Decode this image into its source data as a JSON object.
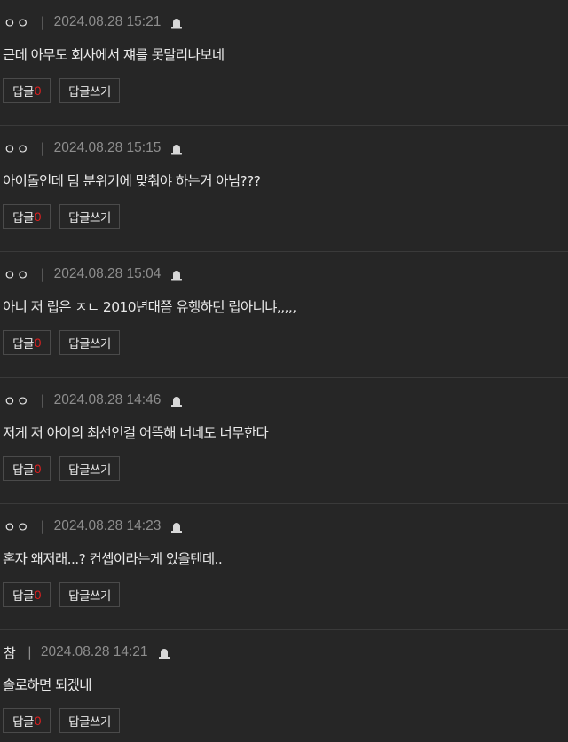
{
  "comments": [
    {
      "author": "ㅇㅇ",
      "separator": "|",
      "date": "2024.08.28 15:21",
      "text": "근데 아무도 회사에서 쟤를 못말리나보네",
      "reply_label": "답글",
      "reply_count": "0",
      "write_reply_label": "답글쓰기"
    },
    {
      "author": "ㅇㅇ",
      "separator": "|",
      "date": "2024.08.28 15:15",
      "text": "아이돌인데 팀 분위기에 맞춰야 하는거 아님???",
      "reply_label": "답글",
      "reply_count": "0",
      "write_reply_label": "답글쓰기"
    },
    {
      "author": "ㅇㅇ",
      "separator": "|",
      "date": "2024.08.28 15:04",
      "text": "아니 저 립은 ㅈㄴ 2010년대쯤 유행하던 립아니냐,,,,,",
      "reply_label": "답글",
      "reply_count": "0",
      "write_reply_label": "답글쓰기"
    },
    {
      "author": "ㅇㅇ",
      "separator": "|",
      "date": "2024.08.28 14:46",
      "text": "저게 저 아이의 최선인걸 어뜩해 너네도 너무한다",
      "reply_label": "답글",
      "reply_count": "0",
      "write_reply_label": "답글쓰기"
    },
    {
      "author": "ㅇㅇ",
      "separator": "|",
      "date": "2024.08.28 14:23",
      "text": "혼자 왜저래...? 컨셉이라는게 있을텐데..",
      "reply_label": "답글",
      "reply_count": "0",
      "write_reply_label": "답글쓰기"
    },
    {
      "author": "참",
      "separator": "|",
      "date": "2024.08.28 14:21",
      "text": "솔로하면 되겠네",
      "reply_label": "답글",
      "reply_count": "0",
      "write_reply_label": "답글쓰기"
    }
  ],
  "icons": {
    "report": "siren-icon"
  },
  "colors": {
    "background": "#262626",
    "reply_count": "#e02020",
    "meta_text": "#8e8e8e"
  }
}
